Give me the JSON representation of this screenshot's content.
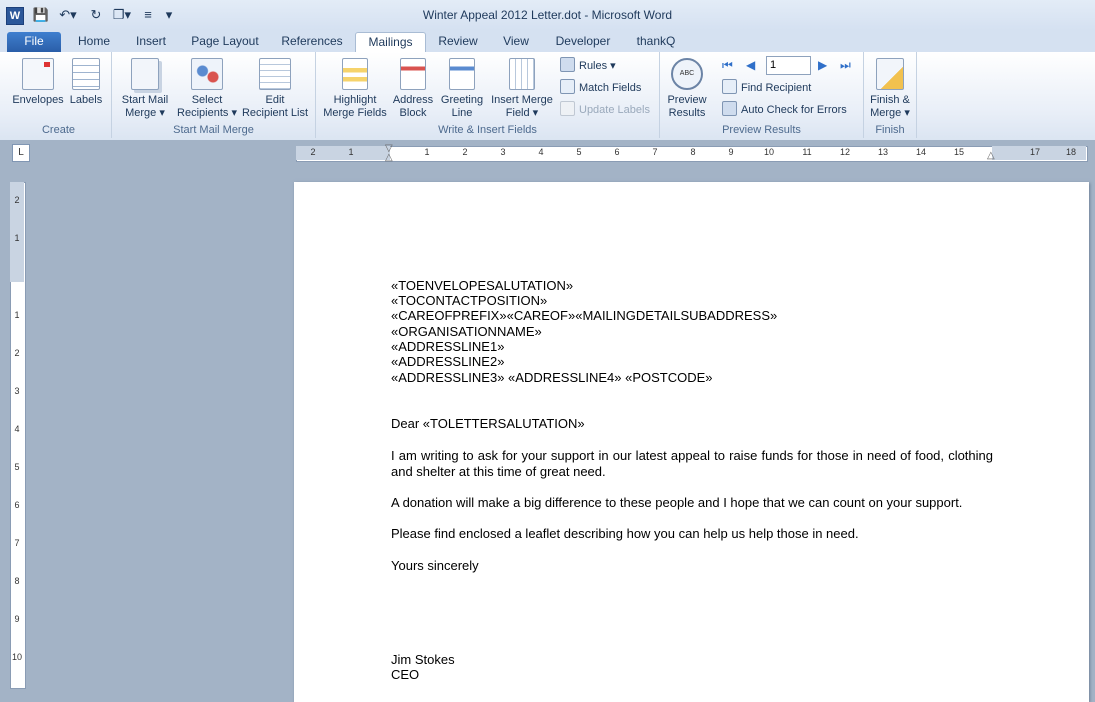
{
  "window": {
    "title": "Winter Appeal 2012 Letter.dot  -  Microsoft Word",
    "app_icon": "W"
  },
  "quick_access": [
    "save-icon",
    "undo-icon",
    "redo-icon",
    "quick-print-icon",
    "format-icon",
    "customize-icon"
  ],
  "tabs": [
    {
      "label": "File"
    },
    {
      "label": "Home"
    },
    {
      "label": "Insert"
    },
    {
      "label": "Page Layout"
    },
    {
      "label": "References"
    },
    {
      "label": "Mailings"
    },
    {
      "label": "Review"
    },
    {
      "label": "View"
    },
    {
      "label": "Developer"
    },
    {
      "label": "thankQ"
    }
  ],
  "ribbon": {
    "create": {
      "label": "Create",
      "envelopes": "Envelopes",
      "labels": "Labels"
    },
    "start": {
      "label": "Start Mail Merge",
      "start_l1": "Start Mail",
      "start_l2": "Merge ▾",
      "select_l1": "Select",
      "select_l2": "Recipients ▾",
      "edit_l1": "Edit",
      "edit_l2": "Recipient List"
    },
    "write": {
      "label": "Write & Insert Fields",
      "highlight_l1": "Highlight",
      "highlight_l2": "Merge Fields",
      "address_l1": "Address",
      "address_l2": "Block",
      "greeting_l1": "Greeting",
      "greeting_l2": "Line",
      "insert_l1": "Insert Merge",
      "insert_l2": "Field ▾",
      "rules": "Rules ▾",
      "match": "Match Fields",
      "update": "Update Labels"
    },
    "preview": {
      "label": "Preview Results",
      "preview_l1": "Preview",
      "preview_l2": "Results",
      "record": "1",
      "find": "Find Recipient",
      "auto_check": "Auto Check for Errors"
    },
    "finish": {
      "label": "Finish",
      "finish_l1": "Finish &",
      "finish_l2": "Merge ▾"
    }
  },
  "ruler": {
    "tab_selector": "L",
    "h_ticks": [
      "2",
      "1",
      "1",
      "2",
      "3",
      "4",
      "5",
      "6",
      "7",
      "8",
      "9",
      "10",
      "11",
      "12",
      "13",
      "14",
      "15",
      "17",
      "18"
    ],
    "v_ticks": [
      "2",
      "1",
      "1",
      "2",
      "3",
      "4",
      "5",
      "6",
      "7",
      "8",
      "9",
      "10"
    ]
  },
  "document": {
    "address_lines": [
      "«TOENVELOPESALUTATION»",
      "«TOCONTACTPOSITION»",
      "«CAREOFPREFIX»«CAREOF»«MAILINGDETAILSUBADDRESS»",
      "«ORGANISATIONNAME»",
      "«ADDRESSLINE1»",
      "«ADDRESSLINE2»",
      "«ADDRESSLINE3»  «ADDRESSLINE4»  «POSTCODE»"
    ],
    "salutation": "Dear «TOLETTERSALUTATION»",
    "para1": "I am writing to ask for your support in our latest appeal to raise funds for those in need of food, clothing and shelter at this time of great need.",
    "para2": "A donation will make a big difference to these people and I hope that we can count on your support.",
    "para3": "Please find enclosed a leaflet describing how you can help us help those in need.",
    "closing": "Yours sincerely",
    "signer_name": "Jim Stokes",
    "signer_title": "CEO"
  }
}
